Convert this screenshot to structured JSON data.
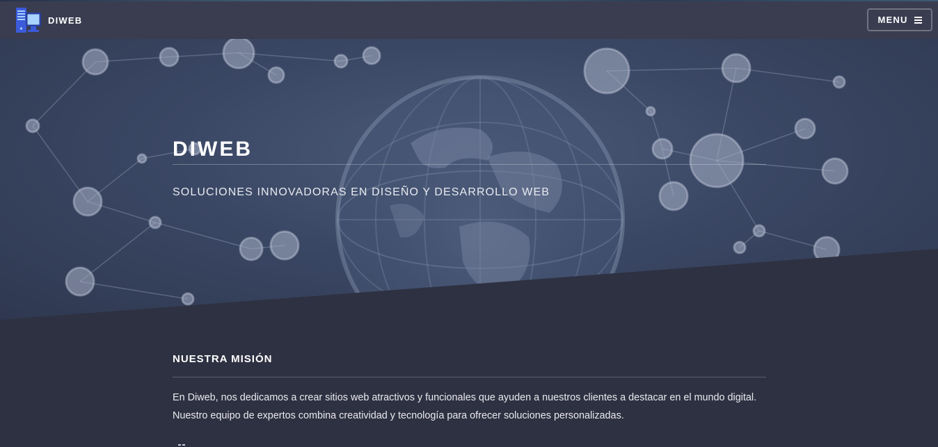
{
  "header": {
    "brand": "DIWEB",
    "menu_label": "MENU",
    "logo_icon": "computer-icon",
    "menu_icon": "bars-icon"
  },
  "hero": {
    "title": "DIWEB",
    "subtitle": "SOLUCIONES INNOVADORAS EN DISEÑO Y DESARROLLO WEB"
  },
  "mission": {
    "title": "NUESTRA MISIÓN",
    "line1": "En Diweb, nos dedicamos a crear sitios web atractivos y funcionales que ayuden a nuestros clientes a destacar en el mundo digital.",
    "line2": "Nuestro equipo de expertos combina creatividad y tecnología para ofrecer soluciones personalizadas."
  },
  "colors": {
    "page_bg": "#2e3141",
    "header_bg": "#3a3d50",
    "logo_blue": "#3b5bdb",
    "logo_screen": "#a8d4ff"
  }
}
